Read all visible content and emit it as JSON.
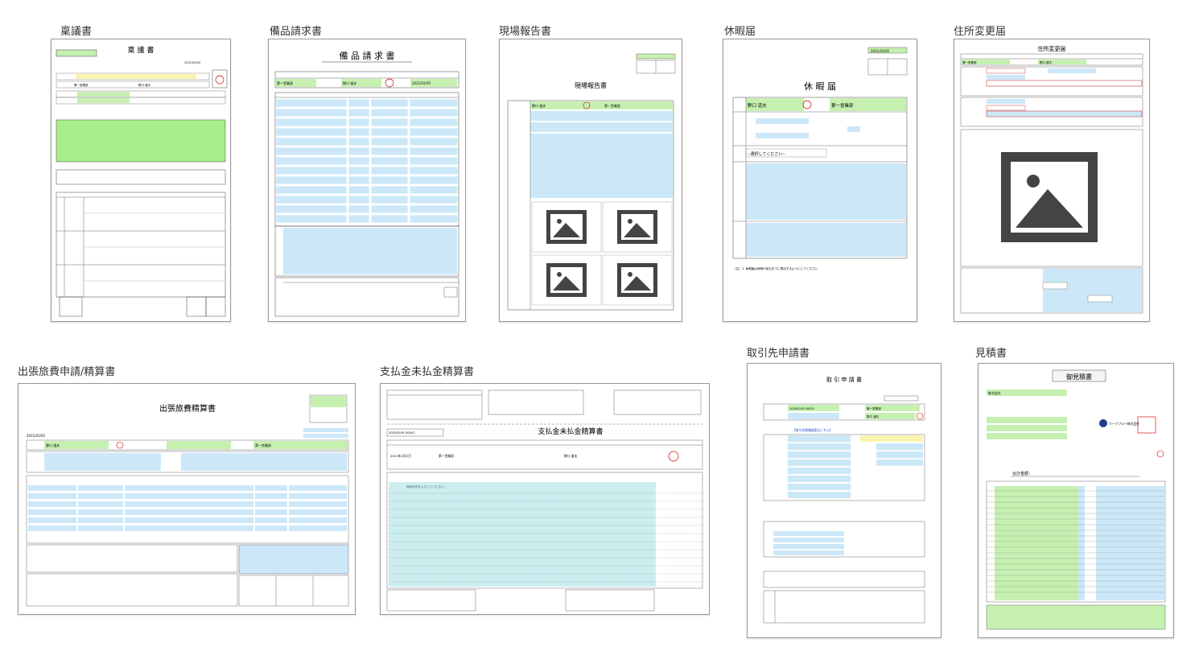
{
  "templates": [
    {
      "label": "稟議書",
      "title": "稟 議 書",
      "dept": "第一営業部",
      "name": "野口 道夫",
      "date": "2021/02/05"
    },
    {
      "label": "備品請求書",
      "title": "備 品 請 求 書",
      "dept": "第一営業部",
      "name": "野口 道夫",
      "date": "2021/02/05"
    },
    {
      "label": "現場報告書",
      "title": "現場報告書",
      "name": "野口 道夫",
      "dept": "第一営業部"
    },
    {
      "label": "休暇届",
      "title": "休 暇 届",
      "name": "野口 道夫",
      "dept": "第一営業部",
      "date": "2021/02/05",
      "select_placeholder": "--選択してください--",
      "note": "（注）１ 休暇届は休暇の前日までに提出するようにしてください"
    },
    {
      "label": "住所変更届",
      "title": "住所変更届",
      "dept": "第一営業部",
      "name": "野口 道夫"
    },
    {
      "label": "出張旅費申請/精算書",
      "title": "出張旅費精算書",
      "date": "2021/02/05",
      "name": "野口 道夫",
      "dept": "第一営業部"
    },
    {
      "label": "支払金未払金精算書",
      "title": "支払金未払金精算書",
      "number": "20200205-00001",
      "date": "2021年2月5日",
      "dept": "第一営業部",
      "name": "野口 道夫",
      "placeholder": "使用目的を入力してください。"
    },
    {
      "label": "取引先申請書",
      "title": "取 引 申 請 書",
      "number": "20200205-00001",
      "dept": "第一営業部",
      "name": "野口 道夫",
      "link": "【取引先情報検索はこちら】"
    },
    {
      "label": "見積書",
      "title": "御見積書",
      "customer": "株式会社",
      "total_label": "合計金額：",
      "company": "ワークフロー株式会社"
    }
  ]
}
